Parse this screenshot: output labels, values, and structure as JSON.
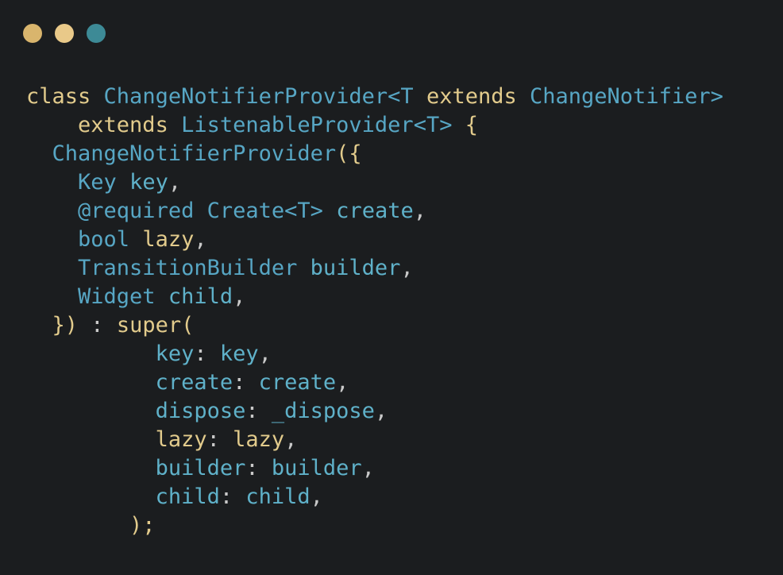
{
  "window": {
    "controls": [
      {
        "name": "close-dot-icon",
        "color": "#d9b56d"
      },
      {
        "name": "minimize-dot-icon",
        "color": "#e9c989"
      },
      {
        "name": "maximize-dot-icon",
        "color": "#3d8a96"
      }
    ]
  },
  "colors": {
    "keyword": "#e2cb8c",
    "type": "#57a6c4",
    "ident": "#5fb1c9",
    "punct": "#c9c9c9",
    "brace": "#e2cb8c"
  },
  "code": {
    "lines": [
      [
        {
          "t": "class",
          "c": "keyword"
        },
        {
          "t": " ",
          "c": "punct"
        },
        {
          "t": "ChangeNotifierProvider",
          "c": "type"
        },
        {
          "t": "<T",
          "c": "type"
        },
        {
          "t": " ",
          "c": "punct"
        },
        {
          "t": "extends",
          "c": "keyword"
        },
        {
          "t": " ",
          "c": "punct"
        },
        {
          "t": "ChangeNotifier",
          "c": "type"
        },
        {
          "t": ">",
          "c": "type"
        }
      ],
      [
        {
          "t": "    ",
          "c": "punct"
        },
        {
          "t": "extends",
          "c": "keyword"
        },
        {
          "t": " ",
          "c": "punct"
        },
        {
          "t": "ListenableProvider",
          "c": "type"
        },
        {
          "t": "<T>",
          "c": "type"
        },
        {
          "t": " ",
          "c": "punct"
        },
        {
          "t": "{",
          "c": "brace"
        }
      ],
      [
        {
          "t": "  ",
          "c": "punct"
        },
        {
          "t": "ChangeNotifierProvider",
          "c": "type"
        },
        {
          "t": "({",
          "c": "brace"
        }
      ],
      [
        {
          "t": "    ",
          "c": "punct"
        },
        {
          "t": "Key",
          "c": "type"
        },
        {
          "t": " ",
          "c": "punct"
        },
        {
          "t": "key",
          "c": "ident"
        },
        {
          "t": ",",
          "c": "punct"
        }
      ],
      [
        {
          "t": "    ",
          "c": "punct"
        },
        {
          "t": "@required",
          "c": "type"
        },
        {
          "t": " ",
          "c": "punct"
        },
        {
          "t": "Create",
          "c": "type"
        },
        {
          "t": "<T>",
          "c": "type"
        },
        {
          "t": " ",
          "c": "punct"
        },
        {
          "t": "create",
          "c": "ident"
        },
        {
          "t": ",",
          "c": "punct"
        }
      ],
      [
        {
          "t": "    ",
          "c": "punct"
        },
        {
          "t": "bool",
          "c": "type"
        },
        {
          "t": " ",
          "c": "punct"
        },
        {
          "t": "lazy",
          "c": "keyword"
        },
        {
          "t": ",",
          "c": "punct"
        }
      ],
      [
        {
          "t": "    ",
          "c": "punct"
        },
        {
          "t": "TransitionBuilder",
          "c": "type"
        },
        {
          "t": " ",
          "c": "punct"
        },
        {
          "t": "builder",
          "c": "ident"
        },
        {
          "t": ",",
          "c": "punct"
        }
      ],
      [
        {
          "t": "    ",
          "c": "punct"
        },
        {
          "t": "Widget",
          "c": "type"
        },
        {
          "t": " ",
          "c": "punct"
        },
        {
          "t": "child",
          "c": "ident"
        },
        {
          "t": ",",
          "c": "punct"
        }
      ],
      [
        {
          "t": "  ",
          "c": "punct"
        },
        {
          "t": "})",
          "c": "brace"
        },
        {
          "t": " : ",
          "c": "punct"
        },
        {
          "t": "super",
          "c": "keyword"
        },
        {
          "t": "(",
          "c": "brace"
        }
      ],
      [
        {
          "t": "          ",
          "c": "punct"
        },
        {
          "t": "key",
          "c": "ident"
        },
        {
          "t": ": ",
          "c": "punct"
        },
        {
          "t": "key",
          "c": "ident"
        },
        {
          "t": ",",
          "c": "punct"
        }
      ],
      [
        {
          "t": "          ",
          "c": "punct"
        },
        {
          "t": "create",
          "c": "ident"
        },
        {
          "t": ": ",
          "c": "punct"
        },
        {
          "t": "create",
          "c": "ident"
        },
        {
          "t": ",",
          "c": "punct"
        }
      ],
      [
        {
          "t": "          ",
          "c": "punct"
        },
        {
          "t": "dispose",
          "c": "ident"
        },
        {
          "t": ": ",
          "c": "punct"
        },
        {
          "t": "_dispose",
          "c": "ident"
        },
        {
          "t": ",",
          "c": "punct"
        }
      ],
      [
        {
          "t": "          ",
          "c": "punct"
        },
        {
          "t": "lazy",
          "c": "keyword"
        },
        {
          "t": ": ",
          "c": "punct"
        },
        {
          "t": "lazy",
          "c": "keyword"
        },
        {
          "t": ",",
          "c": "punct"
        }
      ],
      [
        {
          "t": "          ",
          "c": "punct"
        },
        {
          "t": "builder",
          "c": "ident"
        },
        {
          "t": ": ",
          "c": "punct"
        },
        {
          "t": "builder",
          "c": "ident"
        },
        {
          "t": ",",
          "c": "punct"
        }
      ],
      [
        {
          "t": "          ",
          "c": "punct"
        },
        {
          "t": "child",
          "c": "ident"
        },
        {
          "t": ": ",
          "c": "punct"
        },
        {
          "t": "child",
          "c": "ident"
        },
        {
          "t": ",",
          "c": "punct"
        }
      ],
      [
        {
          "t": "        ",
          "c": "punct"
        },
        {
          "t": ");",
          "c": "brace"
        }
      ]
    ]
  }
}
